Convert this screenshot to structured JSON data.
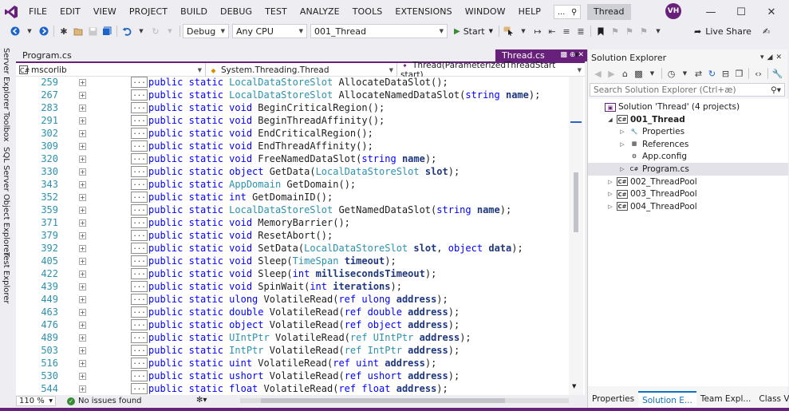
{
  "menu": [
    "FILE",
    "EDIT",
    "VIEW",
    "PROJECT",
    "BUILD",
    "DEBUG",
    "TEST",
    "ANALYZE",
    "TOOLS",
    "EXTENSIONS",
    "WINDOW",
    "HELP"
  ],
  "search_box": "...",
  "solution_title": "Thread",
  "avatar_initials": "VH",
  "toolbar": {
    "config": "Debug",
    "platform": "Any CPU",
    "startup_project": "001_Thread",
    "start_label": "Start",
    "live_share": "Live Share"
  },
  "left_tabs": [
    "Server Explorer",
    "Toolbox",
    "SQL Server Object Explorer",
    "Test Explorer"
  ],
  "doc_tabs": {
    "inactive": "Program.cs",
    "active": "Thread.cs"
  },
  "navbar": {
    "assembly": "mscorlib",
    "type": "System.Threading.Thread",
    "member": "Thread(ParameterizedThreadStart start)"
  },
  "code_lines": [
    {
      "n": "259",
      "pre": "public static ",
      "ret": "LocalDataStoreSlot",
      "retType": true,
      "name": "AllocateDataSlot",
      "args": [],
      "end": "();"
    },
    {
      "n": "267",
      "pre": "public static ",
      "ret": "LocalDataStoreSlot",
      "retType": true,
      "name": "AllocateNamedDataSlot",
      "args": [
        {
          "k": "string",
          "t": false,
          "p": "name"
        }
      ]
    },
    {
      "n": "283",
      "pre": "public static ",
      "ret": "void",
      "retType": false,
      "name": "BeginCriticalRegion",
      "args": []
    },
    {
      "n": "291",
      "pre": "public static ",
      "ret": "void",
      "retType": false,
      "name": "BeginThreadAffinity",
      "args": []
    },
    {
      "n": "302",
      "pre": "public static ",
      "ret": "void",
      "retType": false,
      "name": "EndCriticalRegion",
      "args": []
    },
    {
      "n": "309",
      "pre": "public static ",
      "ret": "void",
      "retType": false,
      "name": "EndThreadAffinity",
      "args": []
    },
    {
      "n": "320",
      "pre": "public static ",
      "ret": "void",
      "retType": false,
      "name": "FreeNamedDataSlot",
      "args": [
        {
          "k": "string",
          "t": false,
          "p": "name"
        }
      ]
    },
    {
      "n": "330",
      "pre": "public static ",
      "ret": "object",
      "retType": false,
      "name": "GetData",
      "args": [
        {
          "k": "LocalDataStoreSlot",
          "t": true,
          "p": "slot"
        }
      ]
    },
    {
      "n": "343",
      "pre": "public static ",
      "ret": "AppDomain",
      "retType": true,
      "name": "GetDomain",
      "args": []
    },
    {
      "n": "352",
      "pre": "public static ",
      "ret": "int",
      "retType": false,
      "name": "GetDomainID",
      "args": []
    },
    {
      "n": "359",
      "pre": "public static ",
      "ret": "LocalDataStoreSlot",
      "retType": true,
      "name": "GetNamedDataSlot",
      "args": [
        {
          "k": "string",
          "t": false,
          "p": "name"
        }
      ]
    },
    {
      "n": "371",
      "pre": "public static ",
      "ret": "void",
      "retType": false,
      "name": "MemoryBarrier",
      "args": []
    },
    {
      "n": "379",
      "pre": "public static ",
      "ret": "void",
      "retType": false,
      "name": "ResetAbort",
      "args": []
    },
    {
      "n": "392",
      "pre": "public static ",
      "ret": "void",
      "retType": false,
      "name": "SetData",
      "args": [
        {
          "k": "LocalDataStoreSlot",
          "t": true,
          "p": "slot"
        },
        {
          "k": "object",
          "t": false,
          "p": "data"
        }
      ]
    },
    {
      "n": "405",
      "pre": "public static ",
      "ret": "void",
      "retType": false,
      "name": "Sleep",
      "args": [
        {
          "k": "TimeSpan",
          "t": true,
          "p": "timeout"
        }
      ]
    },
    {
      "n": "422",
      "pre": "public static ",
      "ret": "void",
      "retType": false,
      "name": "Sleep",
      "args": [
        {
          "k": "int",
          "t": false,
          "p": "millisecondsTimeout"
        }
      ]
    },
    {
      "n": "439",
      "pre": "public static ",
      "ret": "void",
      "retType": false,
      "name": "SpinWait",
      "args": [
        {
          "k": "int",
          "t": false,
          "p": "iterations"
        }
      ]
    },
    {
      "n": "449",
      "pre": "public static ",
      "ret": "ulong",
      "retType": false,
      "name": "VolatileRead",
      "args": [
        {
          "k": "ref ulong",
          "t": false,
          "p": "address"
        }
      ]
    },
    {
      "n": "463",
      "pre": "public static ",
      "ret": "double",
      "retType": false,
      "name": "VolatileRead",
      "args": [
        {
          "k": "ref double",
          "t": false,
          "p": "address"
        }
      ]
    },
    {
      "n": "476",
      "pre": "public static ",
      "ret": "object",
      "retType": false,
      "name": "VolatileRead",
      "args": [
        {
          "k": "ref object",
          "t": false,
          "p": "address"
        }
      ]
    },
    {
      "n": "489",
      "pre": "public static ",
      "ret": "UIntPtr",
      "retType": true,
      "name": "VolatileRead",
      "args": [
        {
          "k": "ref UIntPtr",
          "t": true,
          "p": "address"
        }
      ]
    },
    {
      "n": "503",
      "pre": "public static ",
      "ret": "IntPtr",
      "retType": true,
      "name": "VolatileRead",
      "args": [
        {
          "k": "ref IntPtr",
          "t": true,
          "p": "address"
        }
      ]
    },
    {
      "n": "516",
      "pre": "public static ",
      "ret": "uint",
      "retType": false,
      "name": "VolatileRead",
      "args": [
        {
          "k": "ref uint",
          "t": false,
          "p": "address"
        }
      ]
    },
    {
      "n": "530",
      "pre": "public static ",
      "ret": "ushort",
      "retType": false,
      "name": "VolatileRead",
      "args": [
        {
          "k": "ref ushort",
          "t": false,
          "p": "address"
        }
      ]
    },
    {
      "n": "544",
      "pre": "public static ",
      "ret": "float",
      "retType": false,
      "name": "VolatileRead",
      "args": [
        {
          "k": "ref float",
          "t": false,
          "p": "address"
        }
      ]
    }
  ],
  "status": {
    "zoom": "110 %",
    "issues": "No issues found"
  },
  "solution_explorer": {
    "title": "Solution Explorer",
    "search_placeholder": "Search Solution Explorer (Ctrl+æ)",
    "tree": [
      {
        "label": "Solution 'Thread' (4 projects)",
        "indent": 0,
        "arrow": "",
        "icon": "sln",
        "bold": false
      },
      {
        "label": "001_Thread",
        "indent": 1,
        "arrow": "◢",
        "icon": "cs",
        "bold": true
      },
      {
        "label": "Properties",
        "indent": 2,
        "arrow": "▷",
        "icon": "wrench",
        "bold": false
      },
      {
        "label": "References",
        "indent": 2,
        "arrow": "▷",
        "icon": "refs",
        "bold": false
      },
      {
        "label": "App.config",
        "indent": 2,
        "arrow": "",
        "icon": "config",
        "bold": false
      },
      {
        "label": "Program.cs",
        "indent": 2,
        "arrow": "▷",
        "icon": "csfile",
        "bold": false,
        "selected": true
      },
      {
        "label": "002_ThreadPool",
        "indent": 1,
        "arrow": "▷",
        "icon": "cs",
        "bold": false
      },
      {
        "label": "003_ThreadPool",
        "indent": 1,
        "arrow": "▷",
        "icon": "cs",
        "bold": false
      },
      {
        "label": "004_ThreadPool",
        "indent": 1,
        "arrow": "▷",
        "icon": "cs",
        "bold": false
      }
    ],
    "tabs": [
      "Properties",
      "Solution E...",
      "Team Expl...",
      "Class View"
    ],
    "active_tab": 1
  },
  "colors": {
    "accent": "#68217a",
    "keyword": "#0000ff",
    "type": "#2b91af",
    "line_number": "#2b91af"
  }
}
